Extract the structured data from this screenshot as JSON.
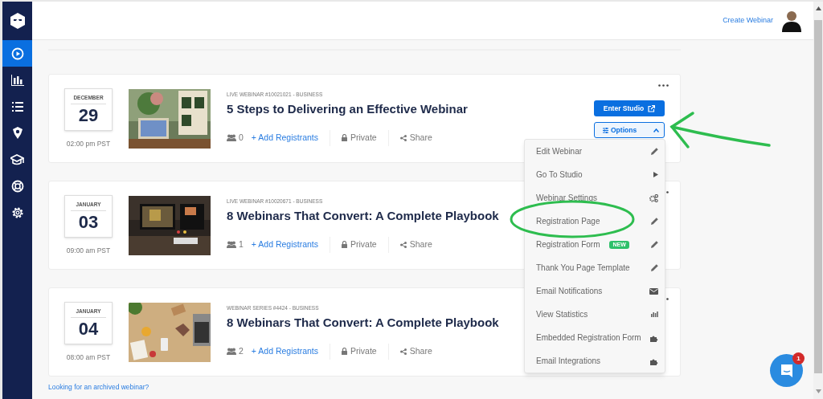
{
  "sidebar": {
    "items": [
      {
        "selected": true
      },
      {
        "selected": false
      },
      {
        "selected": false
      },
      {
        "selected": false
      },
      {
        "selected": false
      },
      {
        "selected": false
      },
      {
        "selected": false
      }
    ]
  },
  "header": {
    "create_link": "Create Webinar"
  },
  "webinars": [
    {
      "month": "DECEMBER",
      "day": "29",
      "time": "02:00 pm PST",
      "label": "LIVE WEBINAR #10021021 - BUSINESS",
      "title": "5 Steps to Delivering an Effective Webinar",
      "registrants": "0",
      "add_link": "+ Add Registrants",
      "privacy": "Private",
      "share": "Share",
      "actions": {
        "enter_studio": "Enter Studio",
        "options": {
          "label": "Options",
          "expanded": true
        }
      }
    },
    {
      "month": "JANUARY",
      "day": "03",
      "time": "09:00 am PST",
      "label": "LIVE WEBINAR #10020671 - BUSINESS",
      "title": "8 Webinars That Convert: A Complete Playbook",
      "registrants": "1",
      "add_link": "+ Add Registrants",
      "privacy": "Private",
      "share": "Share"
    },
    {
      "month": "JANUARY",
      "day": "04",
      "time": "08:00 am PST",
      "label": "WEBINAR SERIES #4424 - BUSINESS",
      "title": "8 Webinars That Convert: A Complete Playbook",
      "registrants": "2",
      "add_link": "+ Add Registrants",
      "privacy": "Private",
      "share": "Share"
    }
  ],
  "options_menu": {
    "items": [
      {
        "label": "Edit Webinar"
      },
      {
        "label": "Go To Studio"
      },
      {
        "label": "Webinar Settings"
      },
      {
        "label": "Registration Page"
      },
      {
        "label": "Registration Form",
        "badge": "NEW"
      },
      {
        "label": "Thank You Page Template"
      },
      {
        "label": "Email Notifications"
      },
      {
        "label": "View Statistics"
      },
      {
        "label": "Embedded Registration Form"
      },
      {
        "label": "Email Integrations"
      }
    ]
  },
  "archived_link": "Looking for an archived webinar?",
  "chat": {
    "badge": "1"
  }
}
